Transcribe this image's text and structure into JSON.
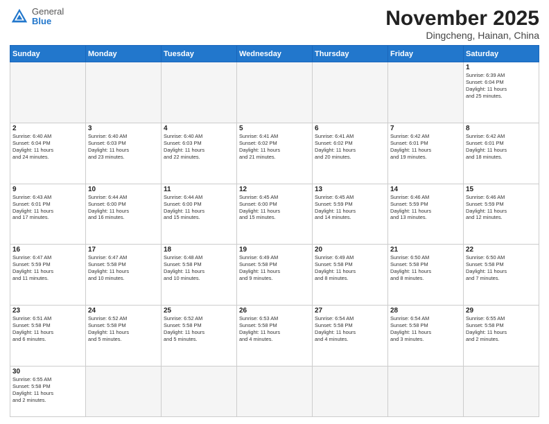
{
  "header": {
    "logo_general": "General",
    "logo_blue": "Blue",
    "month_title": "November 2025",
    "location": "Dingcheng, Hainan, China"
  },
  "weekdays": [
    "Sunday",
    "Monday",
    "Tuesday",
    "Wednesday",
    "Thursday",
    "Friday",
    "Saturday"
  ],
  "weeks": [
    [
      {
        "day": "",
        "info": ""
      },
      {
        "day": "",
        "info": ""
      },
      {
        "day": "",
        "info": ""
      },
      {
        "day": "",
        "info": ""
      },
      {
        "day": "",
        "info": ""
      },
      {
        "day": "",
        "info": ""
      },
      {
        "day": "1",
        "info": "Sunrise: 6:39 AM\nSunset: 6:04 PM\nDaylight: 11 hours\nand 25 minutes."
      }
    ],
    [
      {
        "day": "2",
        "info": "Sunrise: 6:40 AM\nSunset: 6:04 PM\nDaylight: 11 hours\nand 24 minutes."
      },
      {
        "day": "3",
        "info": "Sunrise: 6:40 AM\nSunset: 6:03 PM\nDaylight: 11 hours\nand 23 minutes."
      },
      {
        "day": "4",
        "info": "Sunrise: 6:40 AM\nSunset: 6:03 PM\nDaylight: 11 hours\nand 22 minutes."
      },
      {
        "day": "5",
        "info": "Sunrise: 6:41 AM\nSunset: 6:02 PM\nDaylight: 11 hours\nand 21 minutes."
      },
      {
        "day": "6",
        "info": "Sunrise: 6:41 AM\nSunset: 6:02 PM\nDaylight: 11 hours\nand 20 minutes."
      },
      {
        "day": "7",
        "info": "Sunrise: 6:42 AM\nSunset: 6:01 PM\nDaylight: 11 hours\nand 19 minutes."
      },
      {
        "day": "8",
        "info": "Sunrise: 6:42 AM\nSunset: 6:01 PM\nDaylight: 11 hours\nand 18 minutes."
      }
    ],
    [
      {
        "day": "9",
        "info": "Sunrise: 6:43 AM\nSunset: 6:01 PM\nDaylight: 11 hours\nand 17 minutes."
      },
      {
        "day": "10",
        "info": "Sunrise: 6:44 AM\nSunset: 6:00 PM\nDaylight: 11 hours\nand 16 minutes."
      },
      {
        "day": "11",
        "info": "Sunrise: 6:44 AM\nSunset: 6:00 PM\nDaylight: 11 hours\nand 15 minutes."
      },
      {
        "day": "12",
        "info": "Sunrise: 6:45 AM\nSunset: 6:00 PM\nDaylight: 11 hours\nand 15 minutes."
      },
      {
        "day": "13",
        "info": "Sunrise: 6:45 AM\nSunset: 5:59 PM\nDaylight: 11 hours\nand 14 minutes."
      },
      {
        "day": "14",
        "info": "Sunrise: 6:46 AM\nSunset: 5:59 PM\nDaylight: 11 hours\nand 13 minutes."
      },
      {
        "day": "15",
        "info": "Sunrise: 6:46 AM\nSunset: 5:59 PM\nDaylight: 11 hours\nand 12 minutes."
      }
    ],
    [
      {
        "day": "16",
        "info": "Sunrise: 6:47 AM\nSunset: 5:59 PM\nDaylight: 11 hours\nand 11 minutes."
      },
      {
        "day": "17",
        "info": "Sunrise: 6:47 AM\nSunset: 5:58 PM\nDaylight: 11 hours\nand 10 minutes."
      },
      {
        "day": "18",
        "info": "Sunrise: 6:48 AM\nSunset: 5:58 PM\nDaylight: 11 hours\nand 10 minutes."
      },
      {
        "day": "19",
        "info": "Sunrise: 6:49 AM\nSunset: 5:58 PM\nDaylight: 11 hours\nand 9 minutes."
      },
      {
        "day": "20",
        "info": "Sunrise: 6:49 AM\nSunset: 5:58 PM\nDaylight: 11 hours\nand 8 minutes."
      },
      {
        "day": "21",
        "info": "Sunrise: 6:50 AM\nSunset: 5:58 PM\nDaylight: 11 hours\nand 8 minutes."
      },
      {
        "day": "22",
        "info": "Sunrise: 6:50 AM\nSunset: 5:58 PM\nDaylight: 11 hours\nand 7 minutes."
      }
    ],
    [
      {
        "day": "23",
        "info": "Sunrise: 6:51 AM\nSunset: 5:58 PM\nDaylight: 11 hours\nand 6 minutes."
      },
      {
        "day": "24",
        "info": "Sunrise: 6:52 AM\nSunset: 5:58 PM\nDaylight: 11 hours\nand 5 minutes."
      },
      {
        "day": "25",
        "info": "Sunrise: 6:52 AM\nSunset: 5:58 PM\nDaylight: 11 hours\nand 5 minutes."
      },
      {
        "day": "26",
        "info": "Sunrise: 6:53 AM\nSunset: 5:58 PM\nDaylight: 11 hours\nand 4 minutes."
      },
      {
        "day": "27",
        "info": "Sunrise: 6:54 AM\nSunset: 5:58 PM\nDaylight: 11 hours\nand 4 minutes."
      },
      {
        "day": "28",
        "info": "Sunrise: 6:54 AM\nSunset: 5:58 PM\nDaylight: 11 hours\nand 3 minutes."
      },
      {
        "day": "29",
        "info": "Sunrise: 6:55 AM\nSunset: 5:58 PM\nDaylight: 11 hours\nand 2 minutes."
      }
    ],
    [
      {
        "day": "30",
        "info": "Sunrise: 6:55 AM\nSunset: 5:58 PM\nDaylight: 11 hours\nand 2 minutes."
      },
      {
        "day": "",
        "info": ""
      },
      {
        "day": "",
        "info": ""
      },
      {
        "day": "",
        "info": ""
      },
      {
        "day": "",
        "info": ""
      },
      {
        "day": "",
        "info": ""
      },
      {
        "day": "",
        "info": ""
      }
    ]
  ]
}
